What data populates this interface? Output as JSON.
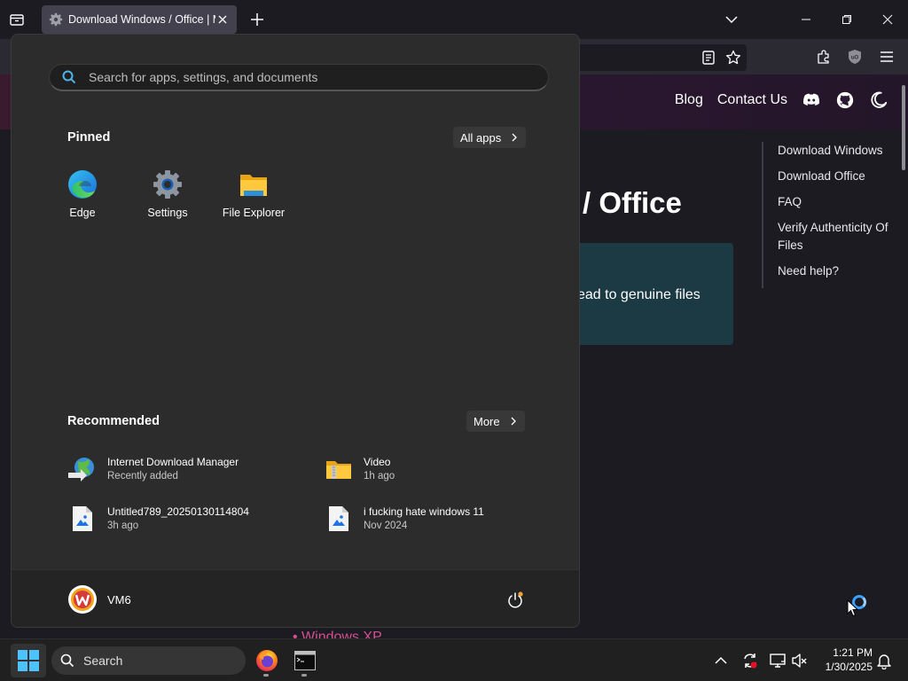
{
  "browser": {
    "tab_title": "Download Windows / Office | M",
    "icons": [
      "tab-list-icon",
      "settings-gear-favicon",
      "close-icon",
      "plus-icon",
      "chevron-down-icon",
      "minimize-icon",
      "maximize-icon",
      "close-window-icon",
      "reader-view-icon",
      "bookmark-star-icon",
      "extensions-icon",
      "ublock-shield-icon",
      "hamburger-menu-icon"
    ]
  },
  "page": {
    "nav_links": [
      "Blog",
      "Contact Us"
    ],
    "nav_icons": [
      "discord-icon",
      "github-icon",
      "moon-icon"
    ],
    "heading_fragment": "/ Office",
    "card_text_fragment": "ead to genuine files",
    "toc": [
      "Download Windows",
      "Download Office",
      "FAQ",
      "Verify Authenticity Of Files",
      "Need help?"
    ],
    "list_fragment": "Windows XP",
    "accent_color": "#d5508f",
    "card_color": "#1c3a44"
  },
  "start_menu": {
    "search_placeholder": "Search for apps, settings, and documents",
    "pinned_title": "Pinned",
    "all_apps_label": "All apps",
    "pinned": [
      {
        "label": "Edge",
        "icon": "edge-icon"
      },
      {
        "label": "Settings",
        "icon": "settings-icon"
      },
      {
        "label": "File Explorer",
        "icon": "file-explorer-icon"
      }
    ],
    "recommended_title": "Recommended",
    "more_label": "More",
    "recommended": [
      {
        "name": "Internet Download Manager",
        "sub": "Recently added",
        "icon": "idm-icon"
      },
      {
        "name": "Video",
        "sub": "1h ago",
        "icon": "zip-folder-icon"
      },
      {
        "name": "Untitled789_20250130114804",
        "sub": "3h ago",
        "icon": "image-file-icon"
      },
      {
        "name": "i fucking hate windows 11",
        "sub": "Nov 2024",
        "icon": "image-file-icon"
      }
    ],
    "user_name": "VM6",
    "power_icon": "power-icon"
  },
  "taskbar": {
    "search_label": "Search",
    "apps": [
      "firefox-icon",
      "terminal-icon"
    ],
    "tray_icons": [
      "chevron-up-icon",
      "sync-icon",
      "display-icon",
      "volume-muted-icon",
      "notification-bell-icon"
    ],
    "time": "1:21 PM",
    "date": "1/30/2025"
  }
}
